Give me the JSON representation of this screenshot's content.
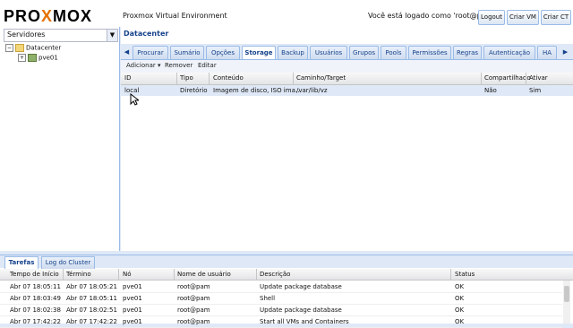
{
  "header": {
    "logo_pre": "PRO",
    "logo_x": "X",
    "logo_post": "MOX",
    "title": "Proxmox Virtual Environment",
    "logged_in": "Você está logado como 'root@pam'",
    "buttons": {
      "logout": "Logout",
      "create_vm": "Criar VM",
      "create_ct": "Criar CT"
    }
  },
  "sidebar": {
    "view": "Servidores",
    "tree": [
      {
        "label": "Datacenter",
        "expander": "−"
      },
      {
        "label": "pve01",
        "expander": "+"
      }
    ]
  },
  "center": {
    "title": "Datacenter",
    "tabs": [
      "Procurar",
      "Sumário",
      "Opções",
      "Storage",
      "Backup",
      "Usuários",
      "Grupos",
      "Pools",
      "Permissões",
      "Regras",
      "Autenticação",
      "HA"
    ],
    "active_tab": "Storage",
    "toolbar": {
      "add": "Adicionar ▾",
      "remove": "Remover",
      "edit": "Editar"
    },
    "columns": [
      "ID",
      "Tipo",
      "Conteúdo",
      "Caminho/Target",
      "Compartilhado",
      "Ativar"
    ],
    "rows": [
      [
        "local",
        "Diretório",
        "Imagem de disco, ISO ima…",
        "/var/lib/vz",
        "Não",
        "Sim"
      ]
    ]
  },
  "bottom": {
    "tabs": [
      "Tarefas",
      "Log do Cluster"
    ],
    "columns": [
      "Tempo de Início",
      "Término",
      "Nó",
      "Nome de usuário",
      "Descrição",
      "Status"
    ],
    "rows": [
      [
        "Abr 07 18:05:11",
        "Abr 07 18:05:21",
        "pve01",
        "root@pam",
        "Update package database",
        "OK"
      ],
      [
        "Abr 07 18:03:49",
        "Abr 07 18:05:11",
        "pve01",
        "root@pam",
        "Shell",
        "OK"
      ],
      [
        "Abr 07 18:02:38",
        "Abr 07 18:02:51",
        "pve01",
        "root@pam",
        "Update package database",
        "OK"
      ],
      [
        "Abr 07 17:42:22",
        "Abr 07 17:42:22",
        "pve01",
        "root@pam",
        "Start all VMs and Containers",
        "OK"
      ]
    ]
  },
  "colors": {
    "accent": "#15428b",
    "logo_orange": "#e57000",
    "panel_bg": "#dfe8f6"
  }
}
